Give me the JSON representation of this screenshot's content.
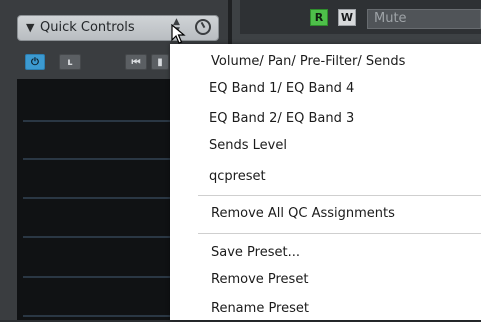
{
  "quick_controls": {
    "header_label": "Quick Controls",
    "icons": {
      "collapse": "triangle-down-icon",
      "updown": "updown-arrows-icon",
      "preset": "preset-dial-icon",
      "power": "power-icon",
      "link": "link-icon",
      "prev": "previous-icon",
      "next": "next-icon"
    },
    "power_symbol": "⏻",
    "link_symbol": "ʟ",
    "prev_symbol": "⏮",
    "next_symbol": "▮"
  },
  "track_strip": {
    "read_label": "R",
    "write_label": "W",
    "parameter_value": "Mute"
  },
  "menu": {
    "items_group1": [
      "Volume/ Pan/ Pre-Filter/ Sends",
      "EQ Band 1/ EQ Band 4",
      "EQ Band 2/ EQ Band 3",
      "Sends Level",
      "qcpreset"
    ],
    "items_group2": [
      "Remove All QC Assignments"
    ],
    "items_group3": [
      "Save Preset...",
      "Remove Preset",
      "Rename Preset"
    ]
  },
  "colors": {
    "power_active": "#3c9ad1",
    "read_active": "#4ec04a"
  }
}
